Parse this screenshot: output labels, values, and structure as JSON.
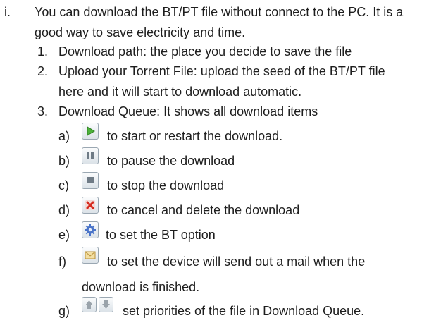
{
  "doc": {
    "main_marker": "i.",
    "intro_line1": "You can download the BT/PT file without connect to the PC. It is a",
    "intro_line2": "good way to save electricity and time.",
    "items": [
      {
        "num": "1.",
        "line1": "Download path: the place you decide to save the file"
      },
      {
        "num": "2.",
        "line1": "Upload your Torrent File: upload the seed of the BT/PT file",
        "line2": "here and it will start to download automatic."
      },
      {
        "num": "3.",
        "line1": "Download Queue: It shows all download items"
      }
    ],
    "subitems": [
      {
        "letter": "a)",
        "icon": "play-icon",
        "text": "to start or restart the download."
      },
      {
        "letter": "b)",
        "icon": "pause-icon",
        "text": "to pause the download"
      },
      {
        "letter": "c)",
        "icon": "stop-icon",
        "text": "to stop the download"
      },
      {
        "letter": "d)",
        "icon": "cancel-delete-icon",
        "text": "to cancel and delete the download"
      },
      {
        "letter": "e)",
        "icon": "gear-icon",
        "text": "to set the BT option"
      },
      {
        "letter": "f)",
        "icon": "mail-icon",
        "text": "to set the device will send out a mail when the",
        "text2": "download is finished."
      },
      {
        "letter": "g)",
        "icon": "up-down-arrows-icon",
        "text": "set priorities of the file in Download Queue."
      }
    ]
  }
}
